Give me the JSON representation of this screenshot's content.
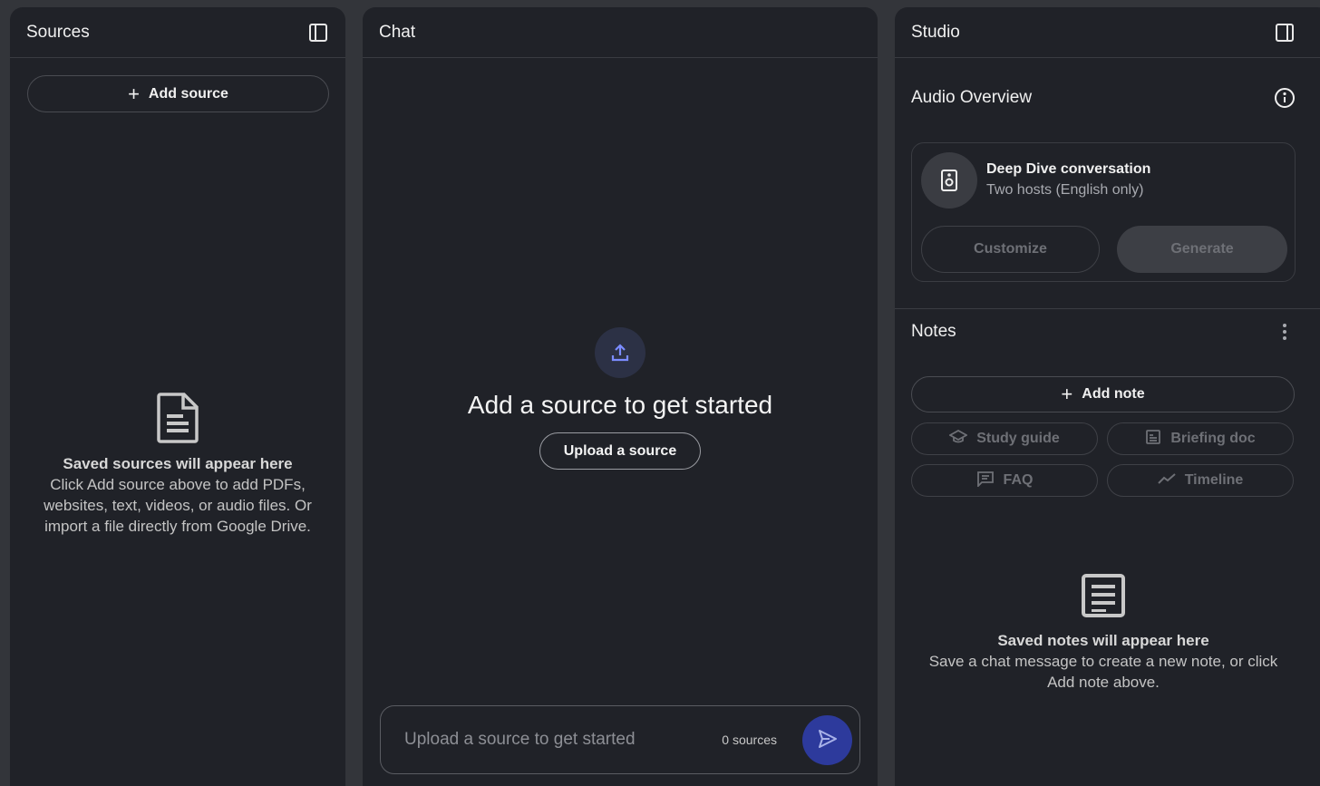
{
  "sources": {
    "title": "Sources",
    "add_source_label": "Add source",
    "empty_title": "Saved sources will appear here",
    "empty_desc": "Click Add source above to add PDFs, websites, text, videos, or audio files. Or import a file directly from Google Drive."
  },
  "chat": {
    "title": "Chat",
    "headline": "Add a source to get started",
    "upload_label": "Upload a source",
    "input_placeholder": "Upload a source to get started",
    "source_count": "0 sources"
  },
  "studio": {
    "title": "Studio",
    "audio_overview": {
      "title": "Audio Overview",
      "card_title": "Deep Dive conversation",
      "card_subtitle": "Two hosts (English only)",
      "customize_label": "Customize",
      "generate_label": "Generate"
    },
    "notes": {
      "title": "Notes",
      "add_note_label": "Add note",
      "chips": [
        "Study guide",
        "Briefing doc",
        "FAQ",
        "Timeline"
      ],
      "empty_title": "Saved notes will appear here",
      "empty_desc": "Save a chat message to create a new note, or click Add note above."
    }
  },
  "colors": {
    "background": "#33353a",
    "panel": "#202228",
    "accent": "#2d3a9c",
    "upload_icon": "#7b8cff"
  },
  "icons": {
    "sources_collapse": "panel-left-icon",
    "studio_collapse": "panel-right-icon",
    "info": "info-icon",
    "speaker": "speaker-icon",
    "notes_menu": "more-vert-icon",
    "send": "send-icon"
  }
}
